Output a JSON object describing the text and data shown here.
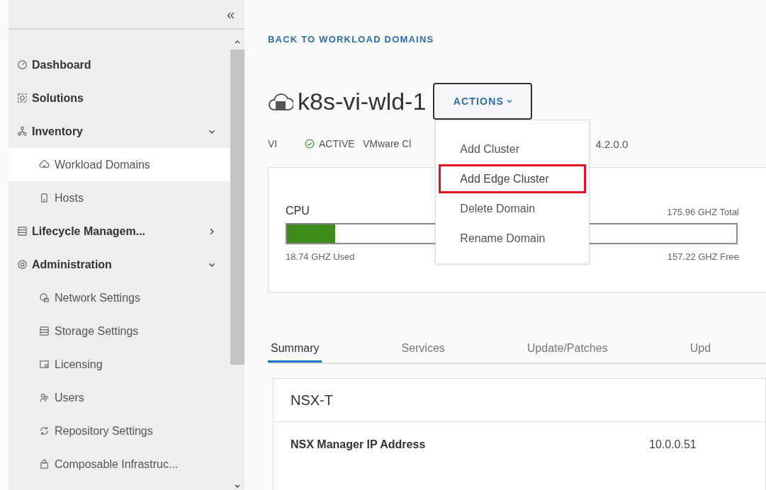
{
  "sidebar": {
    "collapse_glyph": "«",
    "items": [
      {
        "label": "Dashboard"
      },
      {
        "label": "Solutions"
      },
      {
        "label": "Inventory",
        "expanded": true,
        "children": [
          {
            "label": "Workload Domains",
            "selected": true
          },
          {
            "label": "Hosts",
            "selected": false
          }
        ]
      },
      {
        "label": "Lifecycle Managem...",
        "expanded": false
      },
      {
        "label": "Administration",
        "expanded": true,
        "children": [
          {
            "label": "Network Settings",
            "selected": false
          },
          {
            "label": "Storage Settings",
            "selected": false
          },
          {
            "label": "Licensing",
            "selected": false
          },
          {
            "label": "Users",
            "selected": false
          },
          {
            "label": "Repository Settings",
            "selected": false
          },
          {
            "label": "Composable Infrastruc...",
            "selected": false
          }
        ]
      }
    ]
  },
  "back_link": "BACK TO WORKLOAD DOMAINS",
  "domain": {
    "name": "k8s-vi-wld-1",
    "actions_button": "ACTIONS",
    "meta": {
      "type": "VI",
      "status": "ACTIVE",
      "product": "VMware Cl",
      "version": "4.2.0.0"
    }
  },
  "actions_menu": [
    {
      "label": "Add Cluster",
      "highlighted": false
    },
    {
      "label": "Add Edge Cluster",
      "highlighted": true
    },
    {
      "label": "Delete Domain",
      "highlighted": false
    },
    {
      "label": "Rename Domain",
      "highlighted": false
    }
  ],
  "cpu": {
    "title": "CPU",
    "total": "175.96 GHZ Total",
    "level": 0.107,
    "used": "18.74 GHZ Used",
    "free": "157.22 GHZ Free"
  },
  "tabs": [
    {
      "label": "Summary",
      "selected": true
    },
    {
      "label": "Services",
      "selected": false
    },
    {
      "label": "Update/Patches",
      "selected": false
    },
    {
      "label": "Upd",
      "selected": false
    }
  ],
  "nsx": {
    "title": "NSX-T",
    "rows": [
      {
        "label": "NSX Manager IP Address",
        "value": "10.0.0.51"
      }
    ]
  }
}
